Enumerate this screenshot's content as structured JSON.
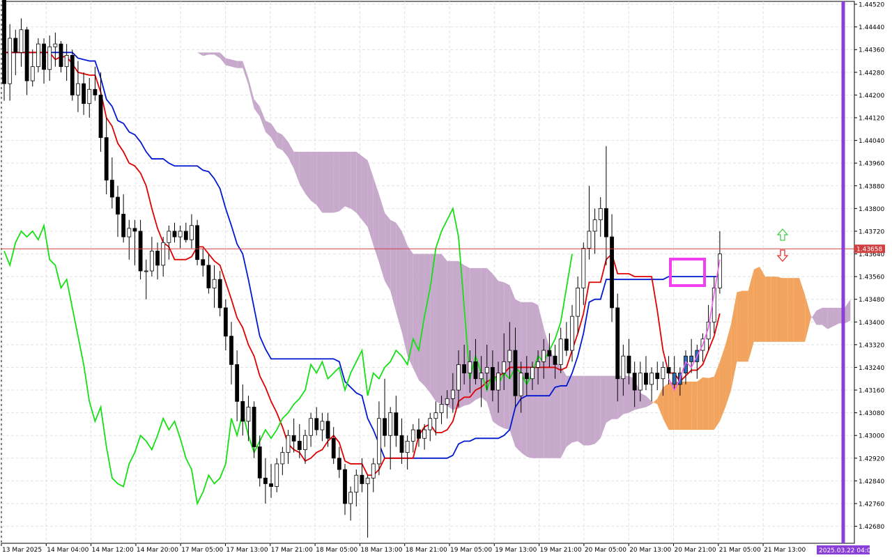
{
  "chart_data": {
    "type": "candlestick",
    "instrument_style": "ichimoku",
    "y_ticks": [
      "1.44520",
      "1.44440",
      "1.44360",
      "1.44280",
      "1.44200",
      "1.44120",
      "1.44040",
      "1.43960",
      "1.43880",
      "1.43800",
      "1.43720",
      "1.43640",
      "1.43560",
      "1.43480",
      "1.43400",
      "1.43320",
      "1.43240",
      "1.43160",
      "1.43080",
      "1.43000",
      "1.42920",
      "1.42840",
      "1.42760",
      "1.42680"
    ],
    "ylim": [
      1.4262,
      1.4453
    ],
    "x_ticks": [
      "13 Mar 2025",
      "14 Mar 04:00",
      "14 Mar 12:00",
      "14 Mar 20:00",
      "17 Mar 05:00",
      "17 Mar 13:00",
      "17 Mar 21:00",
      "18 Mar 05:00",
      "18 Mar 13:00",
      "18 Mar 21:00",
      "19 Mar 05:00",
      "19 Mar 13:00",
      "19 Mar 21:00",
      "20 Mar 05:00",
      "20 Mar 13:00",
      "20 Mar 21:00",
      "21 Mar 05:00",
      "21 Mar 13:00"
    ],
    "current_price": "1.43658",
    "time_marker_label": "2025.03.22 04:00",
    "grid": true,
    "colors": {
      "tenkan": "#e00000",
      "kijun": "#0018d0",
      "chikou": "#14e014",
      "cloud_bear": "#c7a9cc",
      "cloud_bull": "#f2a45e",
      "price_line": "#d04040",
      "marker": "#f040f0",
      "time_marker": "#8a3fd8",
      "bull_candle": "#ffffff",
      "bear_candle": "#000000",
      "highlight_candle": "#2f6db0",
      "arrow_up": "#44cc44",
      "arrow_down": "#e03030",
      "pink_line": "#f060f0"
    },
    "candles": [
      [
        1.4455,
        1.4452,
        1.4418,
        1.4424
      ],
      [
        1.4424,
        1.4445,
        1.4418,
        1.444
      ],
      [
        1.444,
        1.4443,
        1.4427,
        1.4435
      ],
      [
        1.4435,
        1.4447,
        1.443,
        1.4443
      ],
      [
        1.4443,
        1.4444,
        1.442,
        1.4425
      ],
      [
        1.4425,
        1.4436,
        1.4423,
        1.443
      ],
      [
        1.443,
        1.444,
        1.4428,
        1.4438
      ],
      [
        1.4438,
        1.444,
        1.4424,
        1.4429
      ],
      [
        1.4429,
        1.4441,
        1.4425,
        1.4437
      ],
      [
        1.4437,
        1.4442,
        1.443,
        1.4438
      ],
      [
        1.4438,
        1.4439,
        1.4428,
        1.443
      ],
      [
        1.443,
        1.4438,
        1.4425,
        1.4434
      ],
      [
        1.4434,
        1.4436,
        1.4418,
        1.442
      ],
      [
        1.442,
        1.4432,
        1.4414,
        1.4424
      ],
      [
        1.4424,
        1.4428,
        1.4413,
        1.4417
      ],
      [
        1.4417,
        1.4426,
        1.4412,
        1.4422
      ],
      [
        1.4422,
        1.443,
        1.4418,
        1.442
      ],
      [
        1.442,
        1.4428,
        1.44,
        1.4405
      ],
      [
        1.4405,
        1.4412,
        1.4385,
        1.439
      ],
      [
        1.439,
        1.4398,
        1.438,
        1.4384
      ],
      [
        1.4384,
        1.4388,
        1.437,
        1.4378
      ],
      [
        1.4378,
        1.4385,
        1.4368,
        1.437
      ],
      [
        1.437,
        1.4376,
        1.4362,
        1.4373
      ],
      [
        1.4373,
        1.4376,
        1.436,
        1.4372
      ],
      [
        1.4372,
        1.4376,
        1.4355,
        1.4358
      ],
      [
        1.4358,
        1.4362,
        1.4348,
        1.4358
      ],
      [
        1.4358,
        1.437,
        1.4356,
        1.4365
      ],
      [
        1.4365,
        1.4368,
        1.4355,
        1.436
      ],
      [
        1.436,
        1.437,
        1.4356,
        1.4368
      ],
      [
        1.4368,
        1.4374,
        1.4362,
        1.4372
      ],
      [
        1.4372,
        1.4375,
        1.4368,
        1.437
      ],
      [
        1.437,
        1.4374,
        1.4366,
        1.4372
      ],
      [
        1.4372,
        1.4375,
        1.4368,
        1.4369
      ],
      [
        1.4369,
        1.4378,
        1.4366,
        1.4374
      ],
      [
        1.4374,
        1.4376,
        1.436,
        1.4362
      ],
      [
        1.4362,
        1.4366,
        1.4356,
        1.436
      ],
      [
        1.436,
        1.4364,
        1.435,
        1.4352
      ],
      [
        1.4352,
        1.436,
        1.4345,
        1.4355
      ],
      [
        1.4355,
        1.4358,
        1.4342,
        1.4345
      ],
      [
        1.4345,
        1.4348,
        1.433,
        1.4335
      ],
      [
        1.4335,
        1.434,
        1.4318,
        1.4325
      ],
      [
        1.4325,
        1.433,
        1.4305,
        1.4312
      ],
      [
        1.4312,
        1.4318,
        1.43,
        1.4305
      ],
      [
        1.4305,
        1.4314,
        1.4298,
        1.431
      ],
      [
        1.431,
        1.4312,
        1.4292,
        1.4296
      ],
      [
        1.4296,
        1.43,
        1.4282,
        1.4285
      ],
      [
        1.4285,
        1.4292,
        1.4276,
        1.4283
      ],
      [
        1.4283,
        1.429,
        1.4278,
        1.4282
      ],
      [
        1.4282,
        1.4292,
        1.428,
        1.429
      ],
      [
        1.429,
        1.4296,
        1.4286,
        1.4294
      ],
      [
        1.4294,
        1.4302,
        1.429,
        1.43
      ],
      [
        1.43,
        1.4306,
        1.4294,
        1.4298
      ],
      [
        1.4298,
        1.4304,
        1.4292,
        1.4295
      ],
      [
        1.4295,
        1.4302,
        1.429,
        1.43
      ],
      [
        1.43,
        1.4308,
        1.4296,
        1.4306
      ],
      [
        1.4306,
        1.431,
        1.43,
        1.4302
      ],
      [
        1.4302,
        1.4308,
        1.4298,
        1.4305
      ],
      [
        1.4305,
        1.4308,
        1.4296,
        1.4299
      ],
      [
        1.4299,
        1.4303,
        1.429,
        1.4292
      ],
      [
        1.4292,
        1.4296,
        1.4285,
        1.4288
      ],
      [
        1.4288,
        1.429,
        1.4272,
        1.4276
      ],
      [
        1.4276,
        1.4282,
        1.427,
        1.428
      ],
      [
        1.428,
        1.4288,
        1.4275,
        1.4286
      ],
      [
        1.4286,
        1.4292,
        1.428,
        1.4283
      ],
      [
        1.4283,
        1.4286,
        1.4264,
        1.4285
      ],
      [
        1.4285,
        1.4292,
        1.428,
        1.429
      ],
      [
        1.429,
        1.4312,
        1.4286,
        1.4306
      ],
      [
        1.4306,
        1.432,
        1.4296,
        1.43
      ],
      [
        1.43,
        1.431,
        1.4288,
        1.4308
      ],
      [
        1.4308,
        1.4314,
        1.4296,
        1.43
      ],
      [
        1.43,
        1.4306,
        1.429,
        1.4294
      ],
      [
        1.4294,
        1.43,
        1.4288,
        1.4298
      ],
      [
        1.4298,
        1.4304,
        1.4294,
        1.4302
      ],
      [
        1.4302,
        1.4306,
        1.4296,
        1.4299
      ],
      [
        1.4299,
        1.4304,
        1.4295,
        1.4302
      ],
      [
        1.4302,
        1.4308,
        1.4298,
        1.4306
      ],
      [
        1.4306,
        1.4312,
        1.43,
        1.4308
      ],
      [
        1.4308,
        1.4314,
        1.4304,
        1.4311
      ],
      [
        1.4311,
        1.4316,
        1.4306,
        1.4313
      ],
      [
        1.4313,
        1.4322,
        1.4308,
        1.4316
      ],
      [
        1.4316,
        1.433,
        1.431,
        1.4325
      ],
      [
        1.4325,
        1.4332,
        1.4318,
        1.4322
      ],
      [
        1.4322,
        1.433,
        1.4315,
        1.4326
      ],
      [
        1.4326,
        1.4334,
        1.4318,
        1.432
      ],
      [
        1.432,
        1.4328,
        1.431,
        1.4322
      ],
      [
        1.4322,
        1.4332,
        1.4316,
        1.4324
      ],
      [
        1.4324,
        1.433,
        1.4312,
        1.4316
      ],
      [
        1.4316,
        1.4326,
        1.4308,
        1.4322
      ],
      [
        1.4322,
        1.4336,
        1.4316,
        1.4326
      ],
      [
        1.4326,
        1.434,
        1.432,
        1.433
      ],
      [
        1.433,
        1.4338,
        1.431,
        1.4314
      ],
      [
        1.4314,
        1.4326,
        1.4308,
        1.4322
      ],
      [
        1.4322,
        1.4328,
        1.4314,
        1.432
      ],
      [
        1.432,
        1.4326,
        1.4316,
        1.4324
      ],
      [
        1.4324,
        1.433,
        1.4318,
        1.4326
      ],
      [
        1.4326,
        1.4334,
        1.432,
        1.433
      ],
      [
        1.433,
        1.4336,
        1.4324,
        1.4328
      ],
      [
        1.4328,
        1.4332,
        1.432,
        1.4325
      ],
      [
        1.4325,
        1.4338,
        1.4322,
        1.4334
      ],
      [
        1.4334,
        1.434,
        1.4328,
        1.433
      ],
      [
        1.433,
        1.4346,
        1.4326,
        1.4342
      ],
      [
        1.4342,
        1.4356,
        1.4336,
        1.4352
      ],
      [
        1.4352,
        1.4368,
        1.4346,
        1.4366
      ],
      [
        1.4366,
        1.4388,
        1.4362,
        1.4372
      ],
      [
        1.4372,
        1.438,
        1.4364,
        1.4376
      ],
      [
        1.4376,
        1.4384,
        1.437,
        1.438
      ],
      [
        1.438,
        1.4402,
        1.436,
        1.437
      ],
      [
        1.437,
        1.4378,
        1.434,
        1.4345
      ],
      [
        1.4345,
        1.435,
        1.4312,
        1.432
      ],
      [
        1.432,
        1.4332,
        1.4314,
        1.4328
      ],
      [
        1.4328,
        1.4334,
        1.4318,
        1.4322
      ],
      [
        1.4322,
        1.4326,
        1.431,
        1.4316
      ],
      [
        1.4316,
        1.4326,
        1.4312,
        1.4322
      ],
      [
        1.4322,
        1.4328,
        1.4316,
        1.4318
      ],
      [
        1.4318,
        1.4324,
        1.4312,
        1.4322
      ],
      [
        1.4322,
        1.4326,
        1.4316,
        1.432
      ],
      [
        1.432,
        1.4326,
        1.4314,
        1.4324
      ],
      [
        1.4324,
        1.4328,
        1.4318,
        1.4322
      ],
      [
        1.4322,
        1.4328,
        1.4316,
        1.4318
      ],
      [
        1.4318,
        1.4324,
        1.4314,
        1.4322
      ],
      [
        1.4322,
        1.433,
        1.4318,
        1.4328
      ],
      [
        1.4328,
        1.4334,
        1.4322,
        1.4326
      ],
      [
        1.4326,
        1.4332,
        1.432,
        1.433
      ],
      [
        1.433,
        1.4336,
        1.4326,
        1.4334
      ],
      [
        1.4334,
        1.4346,
        1.433,
        1.434
      ],
      [
        1.434,
        1.4356,
        1.4336,
        1.4352
      ],
      [
        1.4352,
        1.4372,
        1.435,
        1.4364
      ]
    ]
  }
}
